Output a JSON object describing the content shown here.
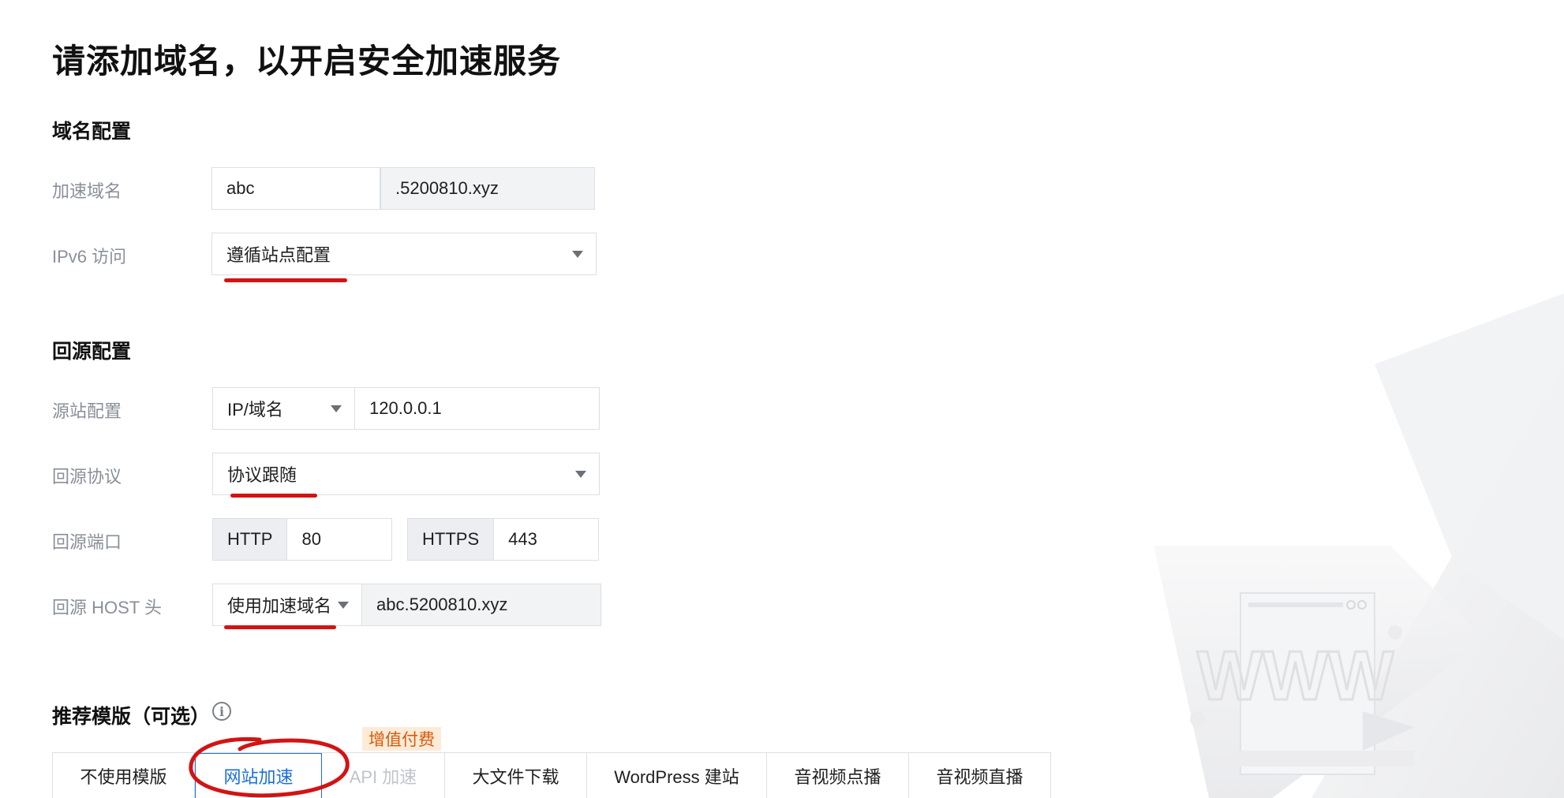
{
  "page": {
    "title": "请添加域名，以开启安全加速服务"
  },
  "domain_config": {
    "section_title": "域名配置",
    "accel_domain": {
      "label": "加速域名",
      "prefix_value": "abc",
      "suffix_value": ".5200810.xyz"
    },
    "ipv6": {
      "label": "IPv6 访问",
      "selected": "遵循站点配置"
    }
  },
  "origin_config": {
    "section_title": "回源配置",
    "origin_site": {
      "label": "源站配置",
      "type_selected": "IP/域名",
      "address_value": "120.0.0.1"
    },
    "protocol": {
      "label": "回源协议",
      "selected": "协议跟随"
    },
    "port": {
      "label": "回源端口",
      "http_label": "HTTP",
      "http_value": "80",
      "https_label": "HTTPS",
      "https_value": "443"
    },
    "host_header": {
      "label": "回源 HOST 头",
      "mode_selected": "使用加速域名",
      "host_value": "abc.5200810.xyz"
    }
  },
  "templates": {
    "section_title": "推荐模版（可选）",
    "info_icon": "info-icon",
    "badge": "增值付费",
    "tabs": [
      {
        "label": "不使用模版",
        "state": "normal"
      },
      {
        "label": "网站加速",
        "state": "active"
      },
      {
        "label": "API 加速",
        "state": "disabled"
      },
      {
        "label": "大文件下载",
        "state": "normal"
      },
      {
        "label": "WordPress 建站",
        "state": "normal"
      },
      {
        "label": "音视频点播",
        "state": "normal"
      },
      {
        "label": "音视频直播",
        "state": "normal"
      }
    ]
  },
  "illustration": {
    "text": "WWW"
  },
  "colors": {
    "accent": "#1a6fd8",
    "annotation": "#d21414",
    "badge_bg": "#fdebd8",
    "badge_text": "#d45a0b"
  }
}
